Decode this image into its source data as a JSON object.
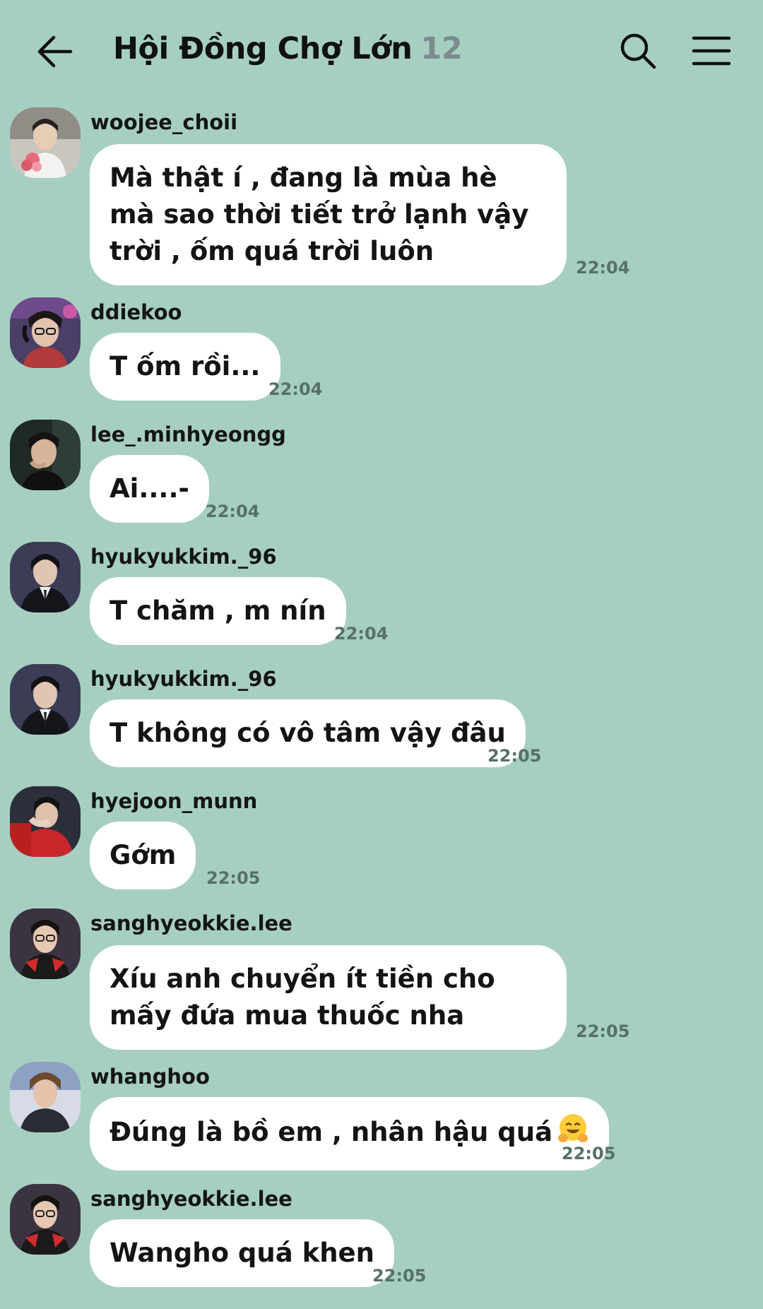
{
  "header": {
    "title": "Hội Đồng Chợ Lớn",
    "member_count": "12",
    "icons": {
      "back": "back-arrow-icon",
      "search": "search-icon",
      "menu": "hamburger-menu-icon"
    }
  },
  "colors": {
    "background": "#a6cfc2",
    "bubble": "#ffffff",
    "time_text": "#57706a",
    "count_text": "#7b8c8d"
  },
  "messages": [
    {
      "sender": "woojee_choii",
      "text": "Mà thật í , đang là mùa hè mà sao thời tiết trở lạnh vậy trời , ốm quá trời luôn",
      "time": "22:04"
    },
    {
      "sender": "ddiekoo",
      "text": "T ốm rồi...",
      "time": "22:04"
    },
    {
      "sender": "lee_.minhyeongg",
      "text": "Ai....-",
      "time": "22:04"
    },
    {
      "sender": "hyukyukkim._96",
      "text": "T chăm , m nín",
      "time": "22:04"
    },
    {
      "sender": "hyukyukkim._96",
      "text": "T không có vô tâm vậy đâu",
      "time": "22:05"
    },
    {
      "sender": "hyejoon_munn",
      "text": "Gớm",
      "time": "22:05"
    },
    {
      "sender": "sanghyeokkie.lee",
      "text": "Xíu anh chuyển ít tiền cho mấy đứa mua thuốc nha",
      "time": "22:05"
    },
    {
      "sender": "whanghoo",
      "text": "Đúng là bồ em , nhân hậu quá",
      "time": "22:05",
      "emoji": "hugging-face-emoji"
    },
    {
      "sender": "sanghyeokkie.lee",
      "text": "Wangho quá khen",
      "time": "22:05"
    }
  ]
}
